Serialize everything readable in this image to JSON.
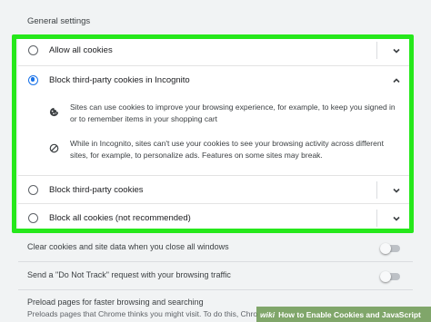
{
  "section_title": "General settings",
  "cookie_options": [
    {
      "label": "Allow all cookies",
      "checked": false,
      "expanded": false
    },
    {
      "label": "Block third-party cookies in Incognito",
      "checked": true,
      "expanded": true
    },
    {
      "label": "Block third-party cookies",
      "checked": false,
      "expanded": false
    },
    {
      "label": "Block all cookies (not recommended)",
      "checked": false,
      "expanded": false
    }
  ],
  "details": [
    {
      "icon": "cookie-icon",
      "text": "Sites can use cookies to improve your browsing experience, for example, to keep you signed in or to remember items in your shopping cart"
    },
    {
      "icon": "block-icon",
      "text": "While in Incognito, sites can't use your cookies to see your browsing activity across different sites, for example, to personalize ads. Features on some sites may break."
    }
  ],
  "settings": [
    {
      "label": "Clear cookies and site data when you close all windows",
      "enabled": false
    },
    {
      "label": "Send a \"Do Not Track\" request with your browsing traffic",
      "enabled": false
    }
  ],
  "preload": {
    "title": "Preload pages for faster browsing and searching",
    "description": "Preloads pages that Chrome thinks you might visit. To do this, Chro"
  },
  "watermark": {
    "brand": "wiki",
    "text": "How to Enable Cookies and JavaScript"
  },
  "colors": {
    "highlight": "#26e81b",
    "accent": "#1a73e8"
  }
}
